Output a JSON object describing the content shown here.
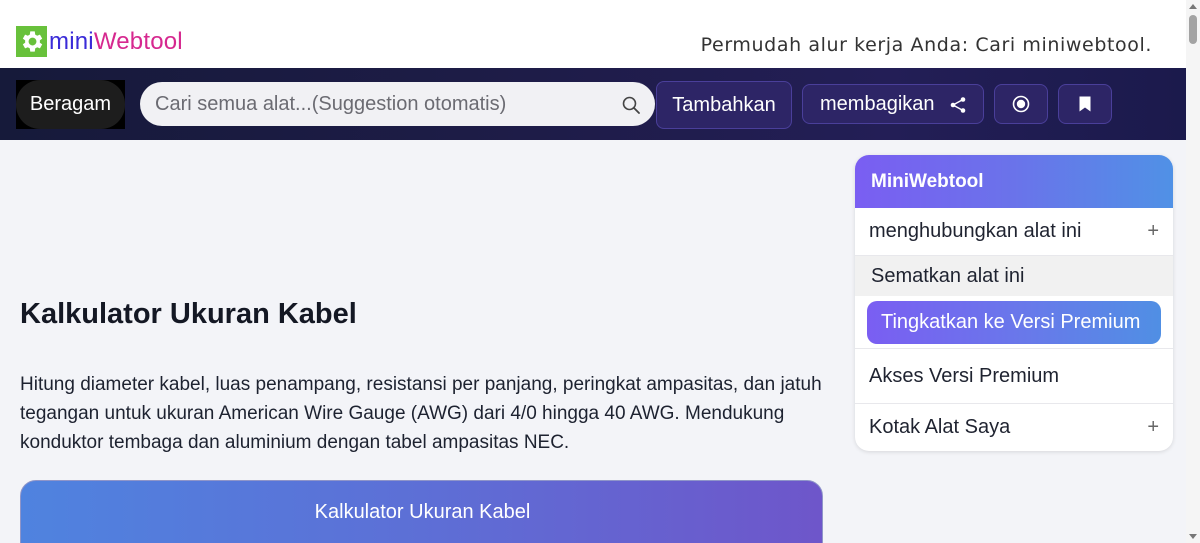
{
  "header": {
    "logo_part1": "mini",
    "logo_part2": "Webtool",
    "tagline": "Permudah alur kerja Anda: Cari miniwebtool.",
    "colors": {
      "logo_mini": "#3a2bd8",
      "logo_web": "#d6288f",
      "gear": "#68c13b"
    }
  },
  "toolbar": {
    "menu_label": "Beragam",
    "search_placeholder": "Cari semua alat...(Suggestion otomatis)",
    "add_label": "Tambahkan",
    "share_label": "membagikan"
  },
  "main": {
    "title": "Kalkulator Ukuran Kabel",
    "description": "Hitung diameter kabel, luas penampang, resistansi per panjang, peringkat ampasitas, dan jatuh tegangan untuk ukuran American Wire Gauge (AWG) dari 4/0 hingga 40 AWG. Mendukung konduktor tembaga dan aluminium dengan tabel ampasitas NEC.",
    "calculator_title": "Kalkulator Ukuran Kabel"
  },
  "sidebar": {
    "title": "MiniWebtool",
    "items": [
      {
        "label": "menghubungkan alat ini",
        "expand": "+"
      },
      {
        "label": "Sematkan alat ini"
      },
      {
        "label": "Tingkatkan ke Versi Premium"
      },
      {
        "label": "Akses Versi Premium"
      },
      {
        "label": "Kotak Alat Saya",
        "expand": "+"
      }
    ]
  },
  "icons": [
    "gear-icon",
    "search-icon",
    "share-icon",
    "record-icon",
    "bookmark-icon"
  ]
}
